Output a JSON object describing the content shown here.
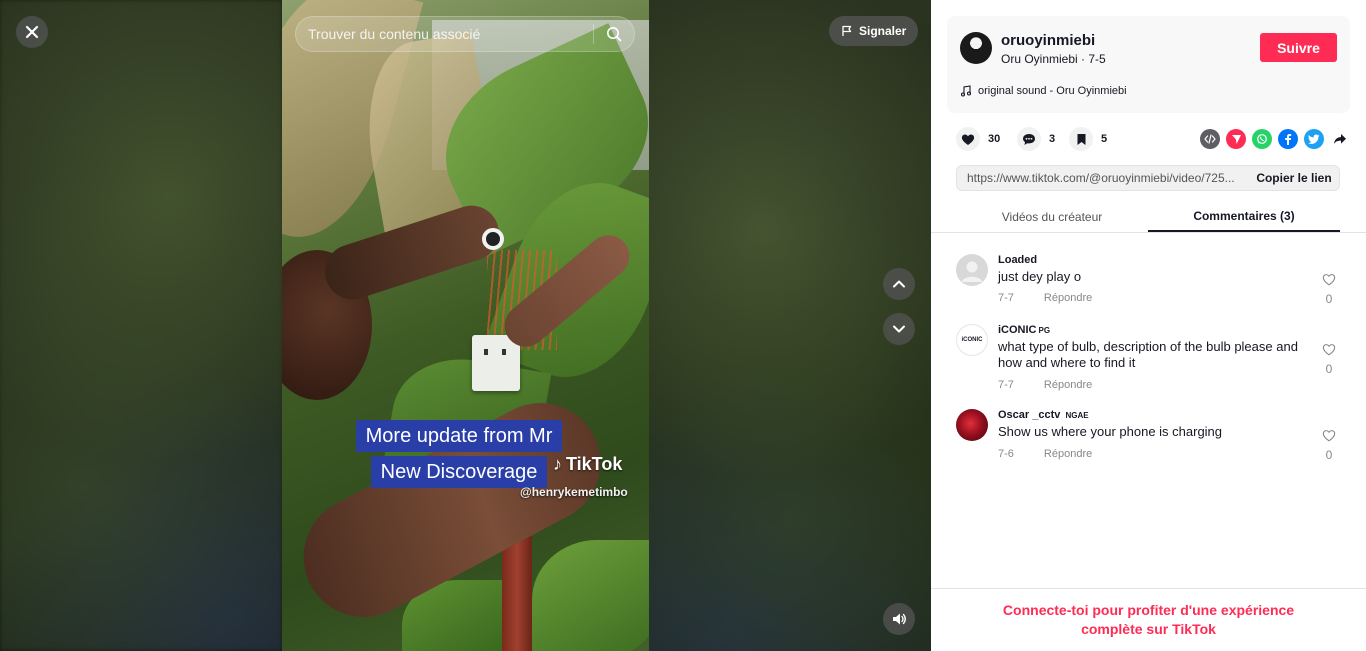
{
  "video": {
    "search_placeholder": "Trouver du contenu associé",
    "report_label": "Signaler",
    "caption_line1": "More update from Mr",
    "caption_line2": "New Discoverage",
    "watermark_brand": "TikTok",
    "watermark_user": "@henrykemetimbo"
  },
  "author": {
    "username": "oruoyinmiebi",
    "display_line": "Oru Oyinmiebi · 7-5",
    "follow_label": "Suivre",
    "sound": "original sound - Oru Oyinmiebi"
  },
  "stats": {
    "likes": "30",
    "comments": "3",
    "saves": "5"
  },
  "share": {
    "icons": [
      "embed-icon",
      "send-icon",
      "whatsapp-icon",
      "facebook-icon",
      "twitter-icon",
      "forward-icon"
    ],
    "colors": {
      "embed": "#5e5e63",
      "send": "#fe2c55",
      "whatsapp": "#25d366",
      "facebook": "#0075fa",
      "twitter": "#1da1f2"
    }
  },
  "link": {
    "url": "https://www.tiktok.com/@oruoyinmiebi/video/725...",
    "copy_label": "Copier le lien"
  },
  "tabs": {
    "creator_videos": "Vidéos du créateur",
    "comments": "Commentaires (3)"
  },
  "comments": [
    {
      "user": "Loaded",
      "tag": "",
      "text": "just dey play o",
      "date": "7-7",
      "reply": "Répondre",
      "likes": "0"
    },
    {
      "user": "iCONIC",
      "tag": "PG",
      "text": "what type of bulb, description of the bulb please and how and where to find it",
      "date": "7-7",
      "reply": "Répondre",
      "likes": "0"
    },
    {
      "user": "Oscar _cctv",
      "tag": "NGAE",
      "text": "Show us where your phone is charging",
      "date": "7-6",
      "reply": "Répondre",
      "likes": "0"
    }
  ],
  "footer": {
    "login_prompt": "Connecte-toi pour profiter d'une expérience complète sur TikTok"
  },
  "colors": {
    "accent": "#fe2c55",
    "text": "#161823",
    "muted": "#888888"
  }
}
